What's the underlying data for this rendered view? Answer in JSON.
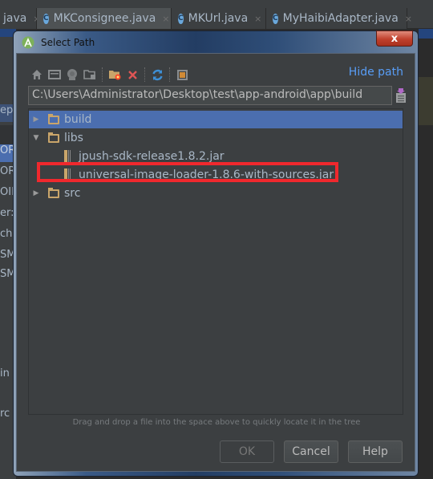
{
  "editor_tabs": [
    {
      "label": "java",
      "icon": "class-icon",
      "active": false,
      "partial": true
    },
    {
      "label": "MKConsignee.java",
      "icon": "class-icon",
      "active": true
    },
    {
      "label": "MKUrl.java",
      "icon": "class-icon",
      "active": false
    },
    {
      "label": "MyHaibiAdapter.java",
      "icon": "class-icon",
      "active": false
    }
  ],
  "tab_close_glyph": "×",
  "tab_class_glyph": "C",
  "left_panel_rows": [
    "ep",
    "ORG",
    "ORI",
    "OID",
    "er:S",
    "che",
    "SMS",
    "SM",
    "in",
    "rc"
  ],
  "dialog": {
    "title": "Select Path",
    "close_glyph": "x",
    "toolbar_icons": [
      "home-icon",
      "desktop-icon",
      "android-module-icon",
      "project-folder-icon",
      "new-folder-icon",
      "delete-icon",
      "refresh-icon",
      "show-hidden-icon"
    ],
    "hide_path_label": "Hide path",
    "path_value": "C:\\Users\\Administrator\\Desktop\\test\\app-android\\app\\build",
    "tree": [
      {
        "label": "build",
        "type": "folder",
        "expanded": false,
        "level": 0,
        "selected": true
      },
      {
        "label": "libs",
        "type": "folder",
        "expanded": true,
        "level": 0,
        "selected": false
      },
      {
        "label": "jpush-sdk-release1.8.2.jar",
        "type": "jar",
        "level": 1,
        "selected": false
      },
      {
        "label": "universal-image-loader-1.8.6-with-sources.jar",
        "type": "jar",
        "level": 1,
        "selected": false,
        "highlighted": true
      },
      {
        "label": "src",
        "type": "folder",
        "expanded": false,
        "level": 0,
        "selected": false
      }
    ],
    "hint": "Drag and drop a file into the space above to quickly locate it in the tree",
    "buttons": {
      "ok": "OK",
      "cancel": "Cancel",
      "help": "Help"
    },
    "ok_enabled": false
  },
  "colors": {
    "accent_link": "#589df6",
    "selection": "#4b6eaf",
    "highlight_box": "#f0282d",
    "folder": "#c9a56a"
  }
}
